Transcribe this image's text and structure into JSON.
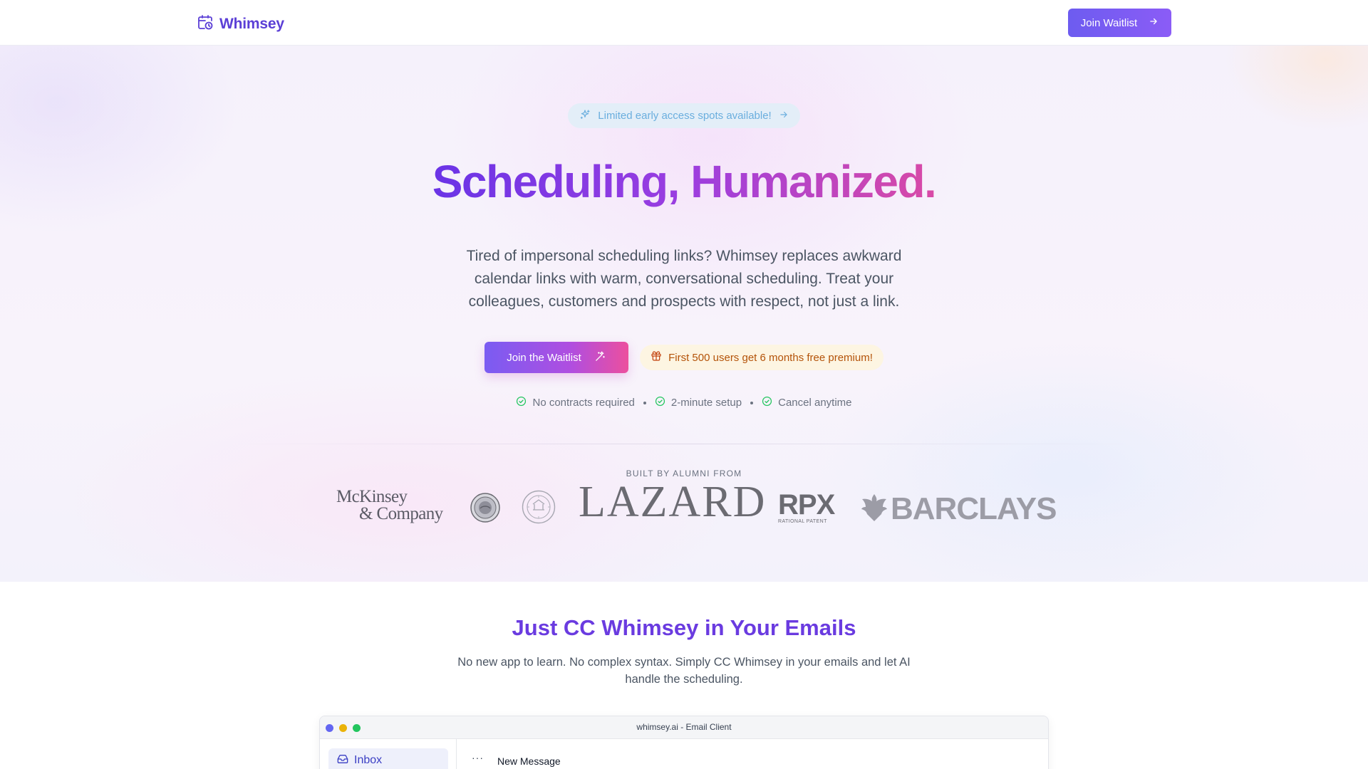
{
  "header": {
    "brand": "Whimsey",
    "nav_button_label": "Join Waitlist"
  },
  "hero": {
    "pill_text": "Limited early access spots available!",
    "title": "Scheduling, Humanized.",
    "subtitle": "Tired of impersonal scheduling links? Whimsey replaces awkward calendar links with warm, conversational scheduling. Treat your colleagues, customers and prospects with respect, not just a link.",
    "cta_label": "Join the Waitlist",
    "promo_text": "First 500 users get 6 months free premium!",
    "features": [
      "No contracts required",
      "2-minute setup",
      "Cancel anytime"
    ]
  },
  "alumni": {
    "label": "BUILT BY ALUMNI FROM",
    "logos": {
      "mckinsey_line1": "McKinsey",
      "mckinsey_line2": "& Company",
      "lazard": "LAZARD",
      "rpx": "RPX",
      "rpx_tagline": "RATIONAL PATENT",
      "barclays": "BARCLAYS"
    }
  },
  "section": {
    "title": "Just CC Whimsey in Your Emails",
    "subtitle": "No new app to learn. No complex syntax. Simply CC Whimsey in your emails and let AI handle the scheduling."
  },
  "email_client": {
    "window_title": "whimsey.ai - Email Client",
    "sidebar_item": "Inbox",
    "compose_title": "New Message",
    "more_label": "···"
  },
  "colors": {
    "brand": "#5b3fd6",
    "gradient_start": "#6a34e6",
    "gradient_end": "#d94aa6",
    "check_green": "#22c55e",
    "promo_text": "#b45309"
  },
  "icons": [
    "calendar-clock-icon",
    "sparkle-icon",
    "arrow-right-icon",
    "magic-wand-icon",
    "gift-icon",
    "check-circle-icon",
    "inbox-icon"
  ]
}
